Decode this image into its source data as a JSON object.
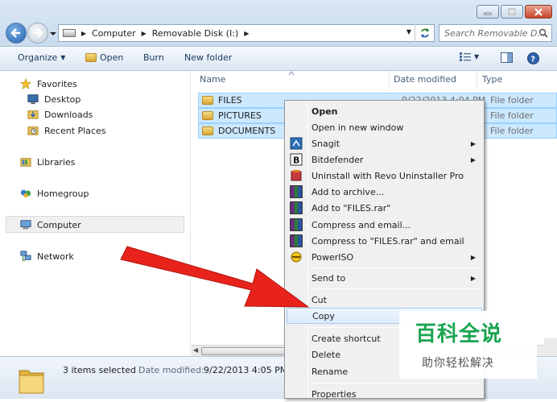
{
  "window": {
    "buttons": [
      "minimize",
      "maximize",
      "close"
    ]
  },
  "address": {
    "crumbs": [
      "Computer",
      "Removable Disk (I:)"
    ],
    "search_placeholder": "Search Removable D..."
  },
  "toolbar": {
    "organize": "Organize",
    "open": "Open",
    "burn": "Burn",
    "new_folder": "New folder"
  },
  "nav": {
    "favorites": "Favorites",
    "desktop": "Desktop",
    "downloads": "Downloads",
    "recent": "Recent Places",
    "libraries": "Libraries",
    "homegroup": "Homegroup",
    "computer": "Computer",
    "network": "Network"
  },
  "columns": {
    "name": "Name",
    "date": "Date modified",
    "type": "Type"
  },
  "files": [
    {
      "name": "FILES",
      "date": "9/22/2013 4:04 PM",
      "type": "File folder"
    },
    {
      "name": "PICTURES",
      "date": "",
      "type": "File folder"
    },
    {
      "name": "DOCUMENTS",
      "date": "",
      "type": "File folder"
    }
  ],
  "details": {
    "selected": "3 items selected",
    "modified_label": "Date modified:",
    "modified_value": "9/22/2013 4:05 PM"
  },
  "menu": {
    "open": "Open",
    "open_new": "Open in new window",
    "snagit": "Snagit",
    "bitdefender": "Bitdefender",
    "revo": "Uninstall with Revo Uninstaller Pro",
    "add_archive": "Add to archive...",
    "add_rar": "Add to \"FILES.rar\"",
    "compress_email": "Compress and email...",
    "compress_rar_email": "Compress to \"FILES.rar\" and email",
    "poweriso": "PowerISO",
    "send_to": "Send to",
    "cut": "Cut",
    "copy": "Copy",
    "create_shortcut": "Create shortcut",
    "delete": "Delete",
    "rename": "Rename",
    "properties": "Properties"
  },
  "watermark": {
    "title": "百科全说",
    "subtitle": "助你轻松解决"
  },
  "colors": {
    "selection": "#cce8ff",
    "arrow": "#e8231c",
    "watermark": "#1aa551"
  }
}
